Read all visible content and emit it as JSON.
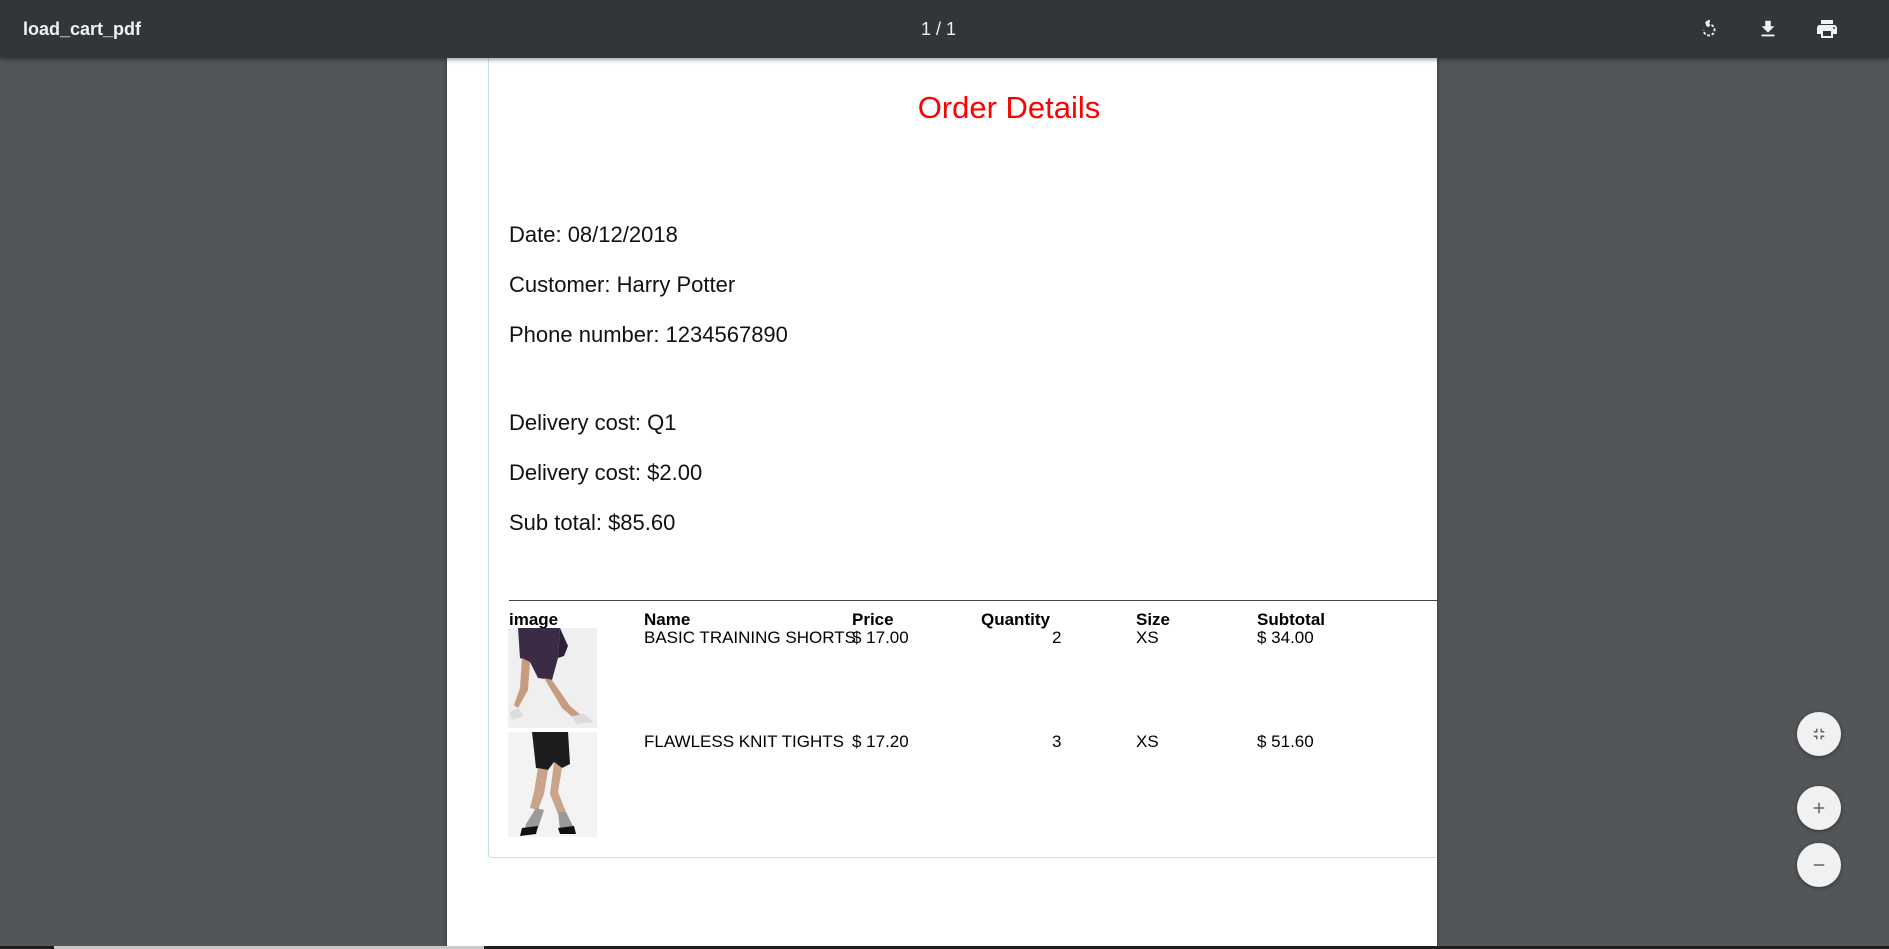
{
  "toolbar": {
    "title": "load_cart_pdf",
    "page_indicator": "1 / 1",
    "icons": [
      "rotate-icon",
      "download-icon",
      "print-icon"
    ]
  },
  "document": {
    "heading": "Order Details",
    "heading_color": "#ff0000",
    "date_line": "Date: 08/12/2018",
    "customer_line": "Customer: Harry Potter",
    "phone_line": "Phone number: 1234567890",
    "delivery_zone_line": "Delivery cost: Q1",
    "delivery_cost_line": "Delivery cost: $2.00",
    "subtotal_line": "Sub total: $85.60",
    "table": {
      "headers": [
        "image",
        "Name",
        "Price",
        "Quantity",
        "Size",
        "Subtotal"
      ],
      "rows": [
        {
          "image": "purple-shorts-photo",
          "name": "BASIC TRAINING SHORTS",
          "price": "$ 17.00",
          "quantity": "2",
          "size": "XS",
          "subtotal": "$ 34.00"
        },
        {
          "image": "black-shorts-photo",
          "name": "FLAWLESS KNIT TIGHTS",
          "price": "$ 17.20",
          "quantity": "3",
          "size": "XS",
          "subtotal": "$ 51.60"
        }
      ]
    }
  },
  "zoom_controls": [
    "fit-to-page-icon",
    "zoom-in-icon",
    "zoom-out-icon"
  ]
}
